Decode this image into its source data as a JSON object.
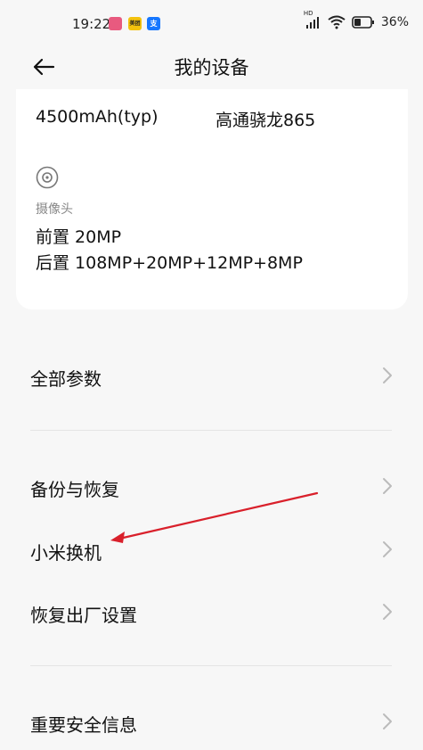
{
  "status_bar": {
    "time": "19:22",
    "app_icons": [
      {
        "name": "gallery-app-icon",
        "color": "#e85a7f",
        "text": ""
      },
      {
        "name": "meituan-app-icon",
        "color": "#f4c20d",
        "text": "美团"
      },
      {
        "name": "alipay-app-icon",
        "color": "#1677ff",
        "text": "支"
      }
    ],
    "network_label": "HD",
    "battery": "36%"
  },
  "header": {
    "title": "我的设备"
  },
  "specs": {
    "battery_value": "4500mAh(typ)",
    "processor_value": "高通骁龙865",
    "camera_label": "摄像头",
    "front_camera": "前置 20MP",
    "rear_camera": "后置 108MP+20MP+12MP+8MP"
  },
  "menu": {
    "all_params": "全部参数",
    "backup_restore": "备份与恢复",
    "mi_mover": "小米换机",
    "factory_reset": "恢复出厂设置",
    "safety_info": "重要安全信息"
  },
  "colors": {
    "annotation_arrow": "#d9202b",
    "background": "#f7f7f7",
    "card": "#ffffff"
  }
}
